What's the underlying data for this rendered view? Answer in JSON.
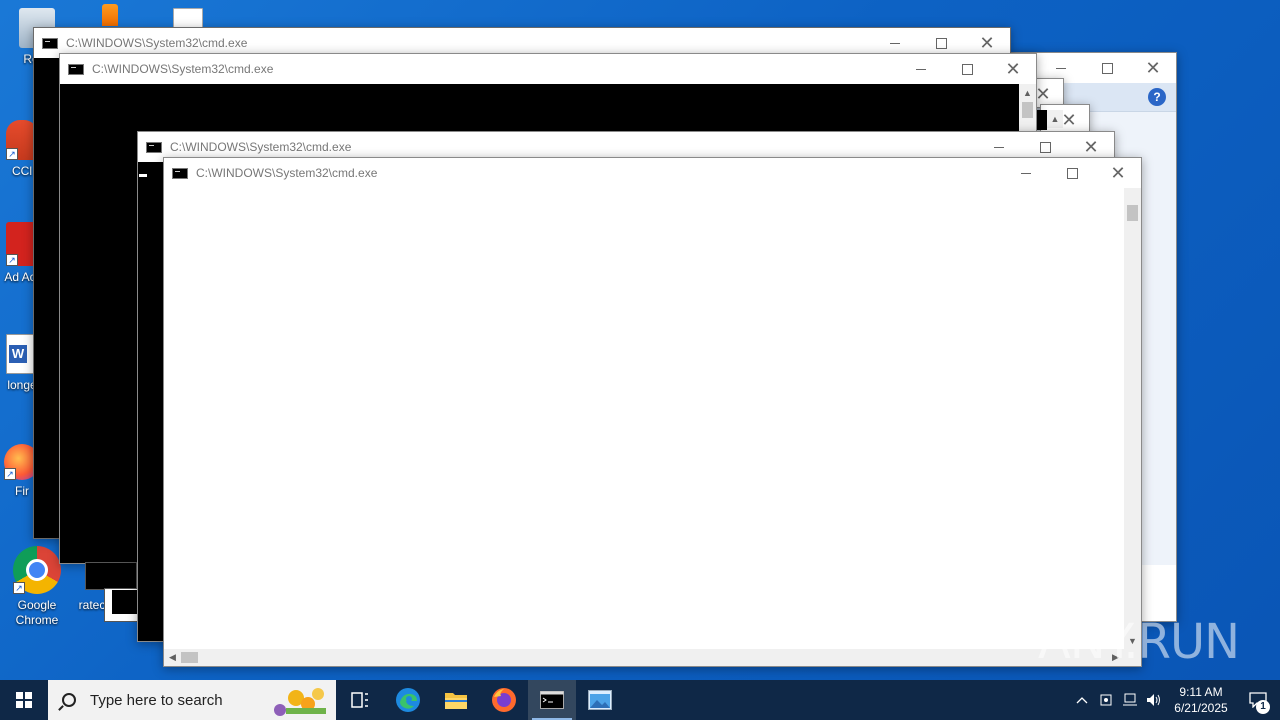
{
  "desktop": {
    "icons": [
      {
        "label": "Recy",
        "name": "recycle-bin"
      },
      {
        "label": "CCl",
        "name": "ccleaner"
      },
      {
        "label": "Ad Acr",
        "name": "adobe-acrobat"
      },
      {
        "label": "longe",
        "name": "word-document"
      },
      {
        "label": "Fir",
        "name": "firefox"
      },
      {
        "label": "Google Chrome",
        "name": "google-chrome"
      },
      {
        "label": "ratec",
        "name": "file-ratec"
      }
    ]
  },
  "windows": [
    {
      "title": "C:\\WINDOWS\\System32\\cmd.exe"
    },
    {
      "title": "C:\\WINDOWS\\System32\\cmd.exe"
    },
    {
      "title": "C:\\WINDOWS\\System32\\cmd.exe"
    },
    {
      "title": "C:\\WINDOWS\\System32\\cmd.exe"
    }
  ],
  "window_buttons": {
    "close": "✕"
  },
  "help_icon_glyph": "?",
  "taskbar": {
    "search_placeholder": "Type here to search",
    "clock_time": "9:11 AM",
    "clock_date": "6/21/2025",
    "notification_count": "1"
  },
  "watermark": "ANY.RUN",
  "colors": {
    "desktop": "#0d62c4",
    "taskbar": "#0f2847",
    "console": "#000000"
  }
}
